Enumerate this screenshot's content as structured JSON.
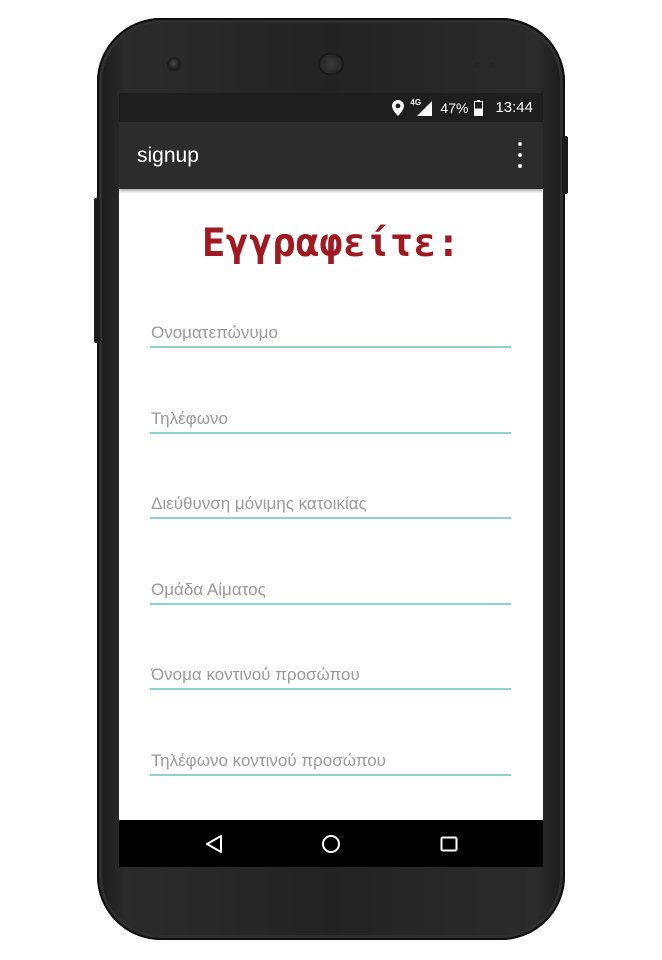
{
  "status_bar": {
    "network": "4G",
    "battery": "47%",
    "time": "13:44",
    "icons": [
      "location-icon",
      "signal-icon",
      "battery-icon"
    ]
  },
  "app_bar": {
    "title": "signup",
    "overflow_icon": "more-vert-icon"
  },
  "form": {
    "heading": "Εγγραφείτε:",
    "fields": [
      {
        "placeholder": "Ονοματεπώνυμο",
        "value": ""
      },
      {
        "placeholder": "Τηλέφωνο",
        "value": ""
      },
      {
        "placeholder": "Διεύθυνση μόνιμης κατοικίας",
        "value": ""
      },
      {
        "placeholder": "Ομάδα Αίματος",
        "value": ""
      },
      {
        "placeholder": "Όνομα κοντινού προσώπου",
        "value": ""
      },
      {
        "placeholder": "Τηλέφωνο κοντινού προσώπου",
        "value": ""
      }
    ]
  },
  "nav_bar": {
    "icons": [
      "back-icon",
      "home-icon",
      "recents-icon"
    ]
  },
  "colors": {
    "heading": "#a01921",
    "field_underline": "#8fd3d1",
    "app_bar": "#2c2c2c",
    "status_bar": "#1e1e1e"
  }
}
